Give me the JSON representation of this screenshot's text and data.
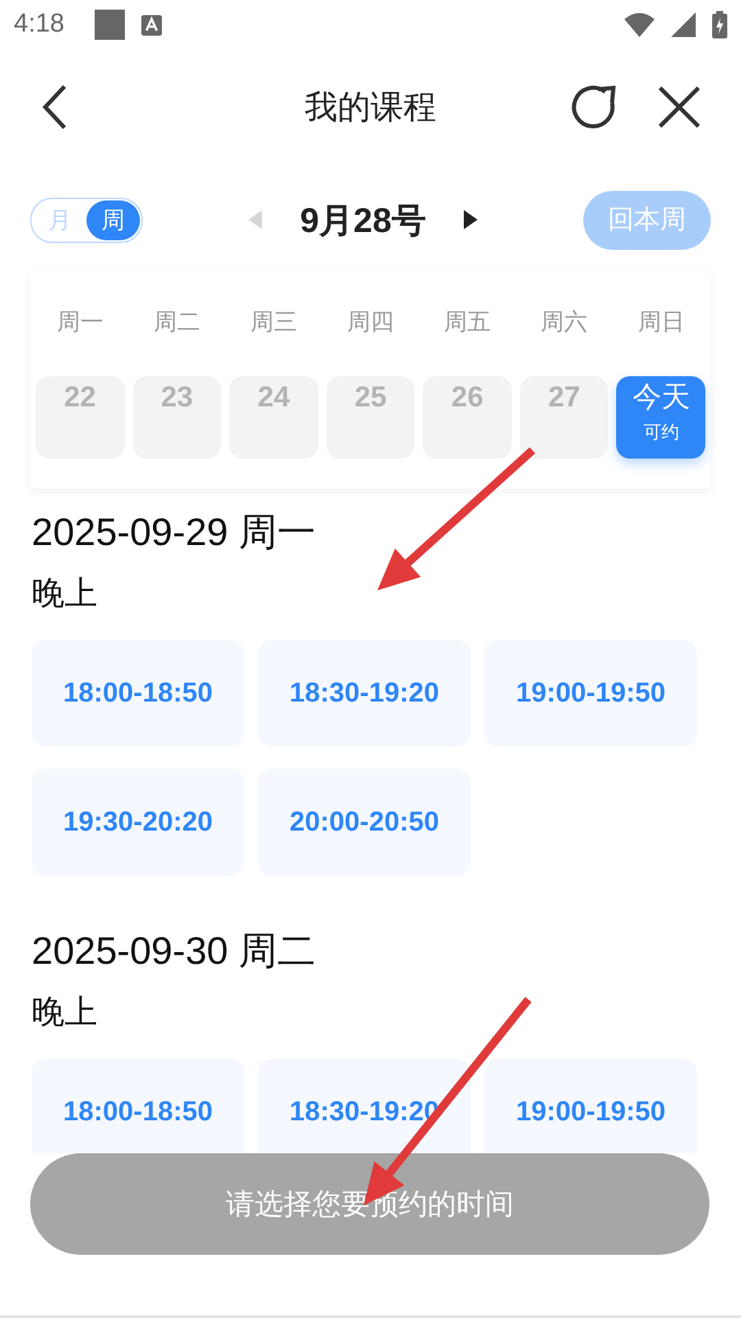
{
  "status_bar": {
    "time": "4:18"
  },
  "header": {
    "title": "我的课程"
  },
  "view_toggle": [
    {
      "label": "月",
      "selected": false
    },
    {
      "label": "周",
      "selected": true
    }
  ],
  "date_nav": {
    "label": "9月28号",
    "prev_disabled": true,
    "next_disabled": false
  },
  "back_to_week": {
    "label": "回本周",
    "disabled": true
  },
  "weekdays": [
    "周一",
    "周二",
    "周三",
    "周四",
    "周五",
    "周六",
    "周日"
  ],
  "days": [
    {
      "label": "22",
      "selected": false,
      "disabled": true
    },
    {
      "label": "23",
      "selected": false,
      "disabled": true
    },
    {
      "label": "24",
      "selected": false,
      "disabled": true
    },
    {
      "label": "25",
      "selected": false,
      "disabled": true
    },
    {
      "label": "26",
      "selected": false,
      "disabled": true
    },
    {
      "label": "27",
      "selected": false,
      "disabled": true
    },
    {
      "label": "今天",
      "sublabel": "可约",
      "selected": true,
      "disabled": false
    }
  ],
  "sections": [
    {
      "date": "2025-09-29 周一",
      "period": "晚上",
      "slots": [
        {
          "kind": "time",
          "time": "18:00-18:50"
        },
        {
          "kind": "time",
          "time": "18:30-19:20"
        },
        {
          "kind": "time",
          "time": "19:00-19:50"
        },
        {
          "kind": "time",
          "time": "19:30-20:20"
        },
        {
          "kind": "time",
          "time": "20:00-20:50"
        }
      ]
    },
    {
      "date": "2025-09-30 周二",
      "period": "晚上",
      "slots": [
        {
          "kind": "time",
          "time": "18:00-18:50"
        },
        {
          "kind": "time",
          "time": "18:30-19:20"
        },
        {
          "kind": "time",
          "time": "19:00-19:50"
        }
      ]
    }
  ],
  "submit": {
    "label": "请选择您要预约的时间",
    "disabled": true
  },
  "annotations": [
    {
      "kind": "arrow",
      "color": "#e03a3a"
    },
    {
      "kind": "arrow",
      "color": "#e03a3a"
    }
  ]
}
